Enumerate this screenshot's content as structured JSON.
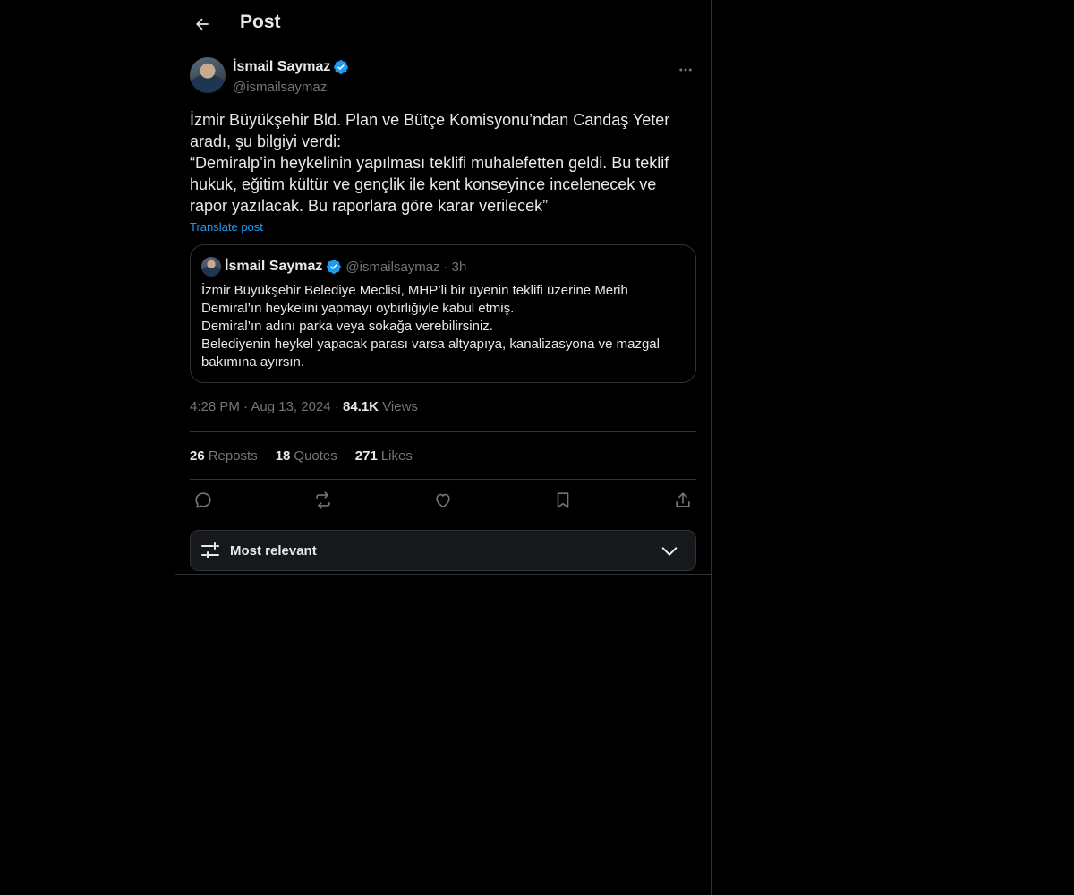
{
  "header": {
    "title": "Post"
  },
  "post": {
    "author_name": "İsmail Saymaz",
    "author_handle": "@ismailsaymaz",
    "text": "İzmir Büyükşehir Bld. Plan ve Bütçe Komisyonu’ndan Candaş Yeter\naradı, şu bilgiyi verdi:\n“Demiralp’in heykelinin yapılması teklifi muhalefetten geldi. Bu teklif hukuk, eğitim kültür ve gençlik ile  kent konseyince incelenecek ve rapor yazılacak. Bu raporlara göre karar verilecek”",
    "translate_label": "Translate post",
    "time": "4:28 PM",
    "date": "Aug 13, 2024",
    "views_count": "84.1K",
    "views_label": "Views",
    "reposts_count": "26",
    "reposts_label": "Reposts",
    "quotes_count": "18",
    "quotes_label": "Quotes",
    "likes_count": "271",
    "likes_label": "Likes"
  },
  "quote": {
    "author_name": "İsmail Saymaz",
    "author_handle": "@ismailsaymaz",
    "separator": "·",
    "time": "3h",
    "text": "İzmir Büyükşehir Belediye Meclisi, MHP’li bir üyenin teklifi üzerine Merih Demiral’ın heykelini yapmayı oybirliğiyle kabul etmiş.\nDemiral’ın adını parka veya sokağa verebilirsiniz.\nBelediyenin heykel yapacak parası varsa altyapıya, kanalizasyona ve mazgal bakımına ayırsın."
  },
  "meta": {
    "dot": "·"
  },
  "sort": {
    "label": "Most relevant"
  },
  "colors": {
    "accent": "#1d9bf0",
    "background": "#000000",
    "border": "#2f3336",
    "muted": "#71767b"
  },
  "icons": [
    "back-arrow-icon",
    "verified-badge-icon",
    "more-icon",
    "reply-icon",
    "repost-icon",
    "like-icon",
    "bookmark-icon",
    "share-icon",
    "sliders-icon",
    "chevron-down-icon"
  ]
}
